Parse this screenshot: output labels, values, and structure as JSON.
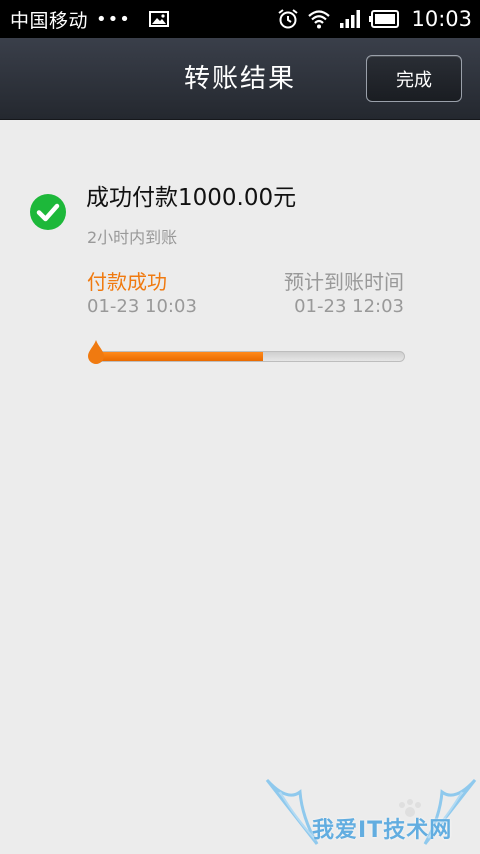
{
  "status_bar": {
    "carrier": "中国移动",
    "dots": "•••",
    "time": "10:03",
    "icons": [
      "image-icon",
      "alarm-icon",
      "wifi-icon",
      "signal-icon",
      "battery-icon"
    ]
  },
  "header": {
    "title": "转账结果",
    "done_label": "完成"
  },
  "result": {
    "amount_text": "成功付款1000.00元",
    "eta_text": "2小时内到账",
    "icon": "check-circle-icon",
    "success_color": "#1db83a"
  },
  "progress": {
    "step_left_label": "付款成功",
    "step_left_time": "01-23 10:03",
    "step_right_label": "预计到账时间",
    "step_right_time": "01-23 12:03",
    "fraction": 0.55,
    "accent_color": "#f07a10"
  },
  "watermark": {
    "text": "我爱IT技术网"
  }
}
